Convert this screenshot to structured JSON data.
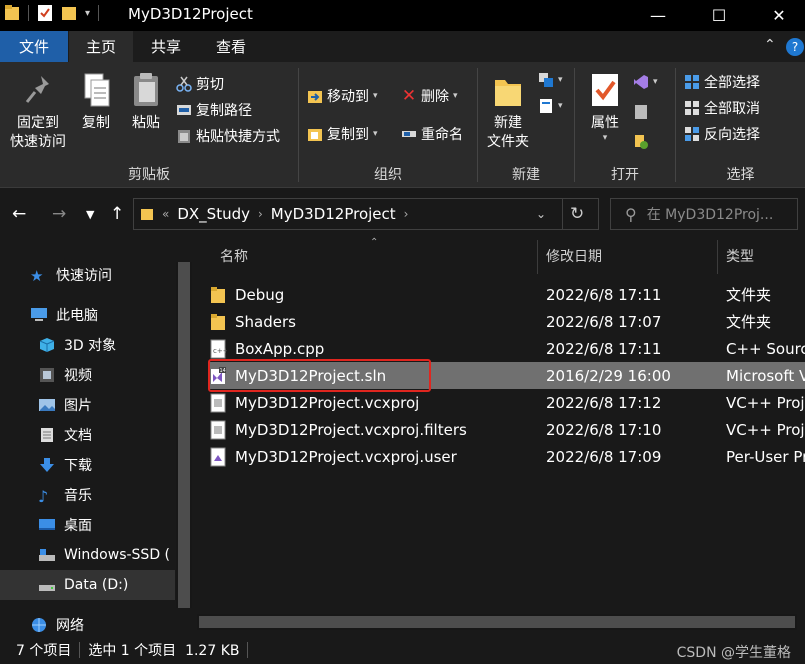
{
  "window": {
    "title": "MyD3D12Project",
    "minimize_glyph": "—",
    "maximize_glyph": "☐",
    "close_glyph": "✕"
  },
  "tabs": [
    {
      "label": "文件"
    },
    {
      "label": "主页"
    },
    {
      "label": "共享"
    },
    {
      "label": "查看"
    }
  ],
  "ribbon": {
    "clipboard": {
      "group_label": "剪贴板",
      "pin_label_1": "固定到",
      "pin_label_2": "快速访问",
      "copy_label": "复制",
      "paste_label": "粘贴",
      "cut_label": "剪切",
      "copy_path_label": "复制路径",
      "paste_shortcut_label": "粘贴快捷方式"
    },
    "organize": {
      "group_label": "组织",
      "move_to_label": "移动到",
      "copy_to_label": "复制到",
      "delete_label": "删除",
      "rename_label": "重命名"
    },
    "new": {
      "group_label": "新建",
      "new_folder_label_1": "新建",
      "new_folder_label_2": "文件夹"
    },
    "open": {
      "group_label": "打开",
      "properties_label": "属性"
    },
    "select": {
      "group_label": "选择",
      "select_all_label": "全部选择",
      "select_none_label": "全部取消",
      "invert_label": "反向选择"
    }
  },
  "address": {
    "prefix": "«",
    "crumbs": [
      "DX_Study",
      "MyD3D12Project"
    ],
    "search_placeholder": "在 MyD3D12Proj..."
  },
  "nav_pane": {
    "items": [
      {
        "label": "快速访问",
        "icon": "star-icon"
      },
      {
        "label": "此电脑",
        "icon": "pc-icon"
      },
      {
        "label": "3D 对象",
        "icon": "cube-icon"
      },
      {
        "label": "视频",
        "icon": "video-icon"
      },
      {
        "label": "图片",
        "icon": "picture-icon"
      },
      {
        "label": "文档",
        "icon": "document-icon"
      },
      {
        "label": "下载",
        "icon": "download-icon"
      },
      {
        "label": "音乐",
        "icon": "music-icon"
      },
      {
        "label": "桌面",
        "icon": "desktop-icon"
      },
      {
        "label": "Windows-SSD (",
        "icon": "drive-icon"
      },
      {
        "label": "Data (D:)",
        "icon": "drive-icon"
      },
      {
        "label": "网络",
        "icon": "network-icon"
      }
    ]
  },
  "file_list": {
    "columns": {
      "name": "名称",
      "date": "修改日期",
      "type": "类型"
    },
    "rows": [
      {
        "name": "Debug",
        "date": "2022/6/8 17:11",
        "type": "文件夹",
        "icon": "folder-icon"
      },
      {
        "name": "Shaders",
        "date": "2022/6/8 17:07",
        "type": "文件夹",
        "icon": "folder-icon"
      },
      {
        "name": "BoxApp.cpp",
        "date": "2022/6/8 17:11",
        "type": "C++ Sourc",
        "icon": "cpp-file-icon"
      },
      {
        "name": "MyD3D12Project.sln",
        "date": "2016/2/29 16:00",
        "type": "Microsoft V",
        "icon": "visual-studio-solution-icon"
      },
      {
        "name": "MyD3D12Project.vcxproj",
        "date": "2022/6/8 17:12",
        "type": "VC++ Proje",
        "icon": "vcxproj-file-icon"
      },
      {
        "name": "MyD3D12Project.vcxproj.filters",
        "date": "2022/6/8 17:10",
        "type": "VC++ Proje",
        "icon": "filters-file-icon"
      },
      {
        "name": "MyD3D12Project.vcxproj.user",
        "date": "2022/6/8 17:09",
        "type": "Per-User Pr",
        "icon": "user-file-icon"
      }
    ]
  },
  "status": {
    "item_count": "7 个项目",
    "selection": "选中 1 个项目  1.27 KB"
  },
  "watermark": "CSDN @学生董格",
  "colors": {
    "file_tab": "#1f5fa8",
    "selection": "#707070",
    "highlight_box": "#e0261f",
    "folder": "#f3c451"
  }
}
